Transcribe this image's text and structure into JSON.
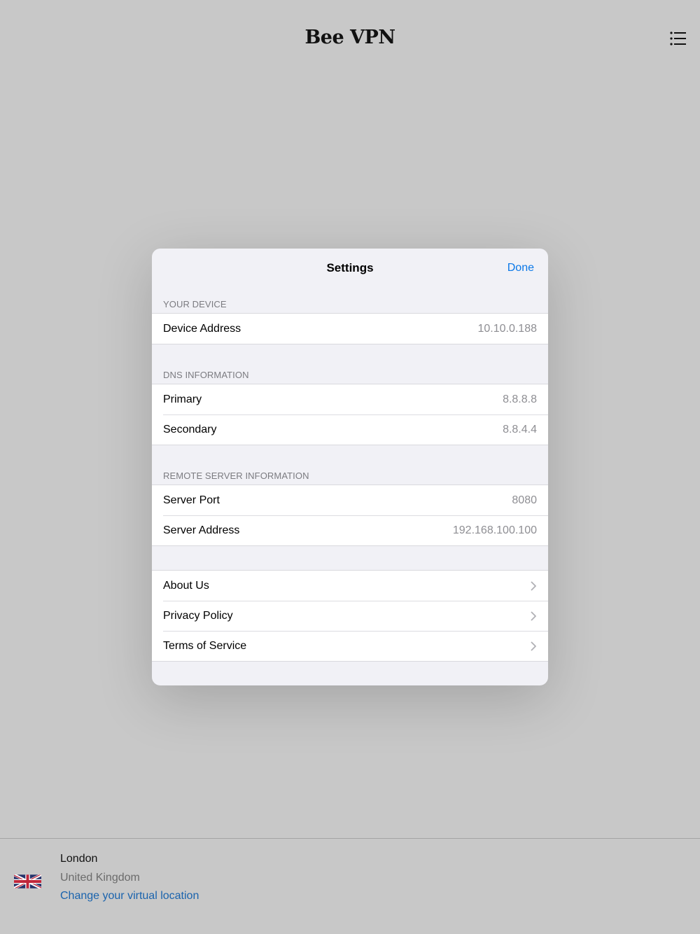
{
  "app": {
    "title": "Bee VPN",
    "menu_icon": "list-icon"
  },
  "settings": {
    "title": "Settings",
    "done_label": "Done",
    "sections": {
      "device": {
        "header": "YOUR DEVICE",
        "rows": [
          {
            "label": "Device Address",
            "value": "10.10.0.188"
          }
        ]
      },
      "dns": {
        "header": "DNS INFORMATION",
        "rows": [
          {
            "label": "Primary",
            "value": "8.8.8.8"
          },
          {
            "label": "Secondary",
            "value": "8.8.4.4"
          }
        ]
      },
      "server": {
        "header": "REMOTE SERVER INFORMATION",
        "rows": [
          {
            "label": "Server Port",
            "value": "8080"
          },
          {
            "label": "Server Address",
            "value": "192.168.100.100"
          }
        ]
      },
      "links": {
        "rows": [
          {
            "label": "About Us",
            "icon": "chevron-right-icon"
          },
          {
            "label": "Privacy Policy",
            "icon": "chevron-right-icon"
          },
          {
            "label": "Terms of Service",
            "icon": "chevron-right-icon"
          }
        ]
      }
    }
  },
  "location": {
    "flag_icon": "uk-flag-icon",
    "city": "London",
    "country": "United Kingdom",
    "change_label": "Change your virtual location"
  },
  "colors": {
    "accent": "#0a78e8",
    "link": "#1a63ad",
    "backdrop": "#c8c8c8",
    "modal_bg": "#f1f1f6"
  }
}
